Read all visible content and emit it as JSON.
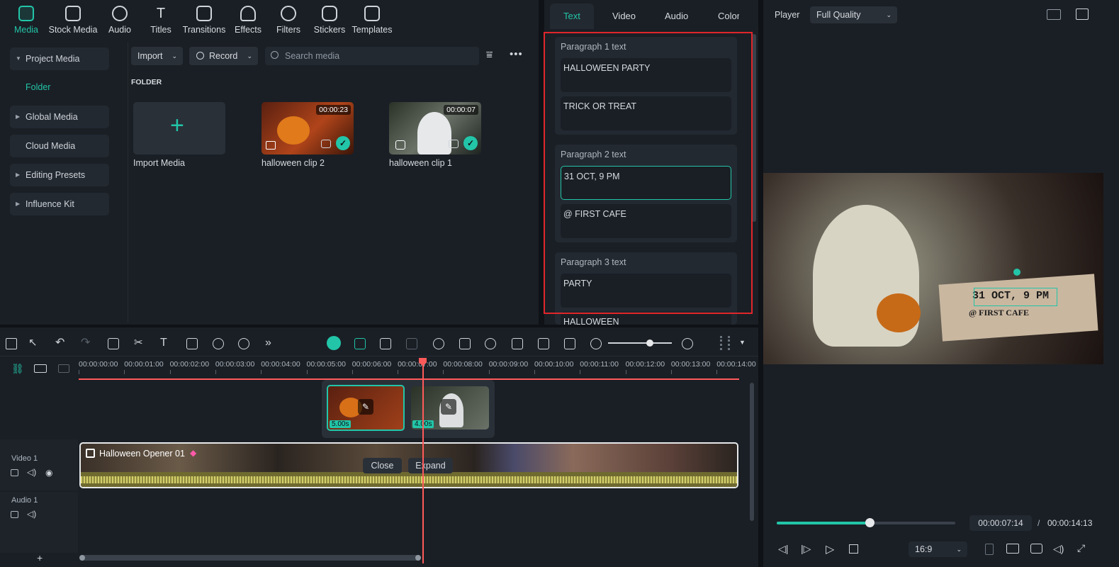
{
  "toolbar": {
    "items": [
      {
        "label": "Media",
        "icon": "media-icon",
        "active": true
      },
      {
        "label": "Stock Media",
        "icon": "stock-media-icon"
      },
      {
        "label": "Audio",
        "icon": "audio-icon"
      },
      {
        "label": "Titles",
        "icon": "titles-icon"
      },
      {
        "label": "Transitions",
        "icon": "transitions-icon"
      },
      {
        "label": "Effects",
        "icon": "effects-icon"
      },
      {
        "label": "Filters",
        "icon": "filters-icon"
      },
      {
        "label": "Stickers",
        "icon": "stickers-icon"
      },
      {
        "label": "Templates",
        "icon": "templates-icon"
      }
    ]
  },
  "sidebar": {
    "items": [
      {
        "label": "Project Media",
        "expandable": true
      },
      {
        "label": "Folder"
      },
      {
        "label": "Global Media",
        "expandable": true
      },
      {
        "label": "Cloud Media"
      },
      {
        "label": "Editing Presets",
        "expandable": true
      },
      {
        "label": "Influence Kit",
        "expandable": true
      }
    ]
  },
  "media": {
    "import_label": "Import",
    "record_label": "Record",
    "search_placeholder": "Search media",
    "folder_heading": "FOLDER",
    "items": [
      {
        "name": "Import Media"
      },
      {
        "name": "halloween clip 2",
        "duration": "00:00:23"
      },
      {
        "name": "halloween clip 1",
        "duration": "00:00:07"
      }
    ]
  },
  "props": {
    "tabs": [
      "Text",
      "Video",
      "Audio",
      "Color"
    ],
    "active_tab": "Text",
    "groups": [
      {
        "label": "Paragraph 1 text",
        "fields": [
          "HALLOWEEN PARTY",
          "TRICK OR TREAT"
        ]
      },
      {
        "label": "Paragraph 2 text",
        "fields": [
          "31 OCT, 9 PM",
          "@ FIRST CAFE"
        ]
      },
      {
        "label": "Paragraph 3 text",
        "fields": [
          "PARTY",
          "HALLOWEEN"
        ]
      }
    ]
  },
  "player": {
    "label": "Player",
    "quality": "Full Quality",
    "overlay_line1": "31 OCT, 9 PM",
    "overlay_line2": "@ FIRST CAFE",
    "current_time": "00:00:07:14",
    "separator": "/",
    "total_time": "00:00:14:13",
    "aspect": "16:9",
    "progress": 0.52
  },
  "timeline": {
    "ruler": [
      "00:00:00:00",
      "00:00:01:00",
      "00:00:02:00",
      "00:00:03:00",
      "00:00:04:00",
      "00:00:05:00",
      "00:00:06:00",
      "00:00:07:00",
      "00:00:08:00",
      "00:00:09:00",
      "00:00:10:00",
      "00:00:11:00",
      "00:00:12:00",
      "00:00:13:00",
      "00:00:14:00"
    ],
    "popup_clips": [
      {
        "duration": "5.00s"
      },
      {
        "duration": "4.00s"
      }
    ],
    "video_track_label": "Video 1",
    "audio_track_label": "Audio 1",
    "clip_title": "Halloween Opener 01",
    "close_label": "Close",
    "expand_label": "Expand"
  },
  "colors": {
    "accent": "#22c5a8",
    "playhead": "#ff5a5a",
    "highlight": "#e0262b"
  }
}
